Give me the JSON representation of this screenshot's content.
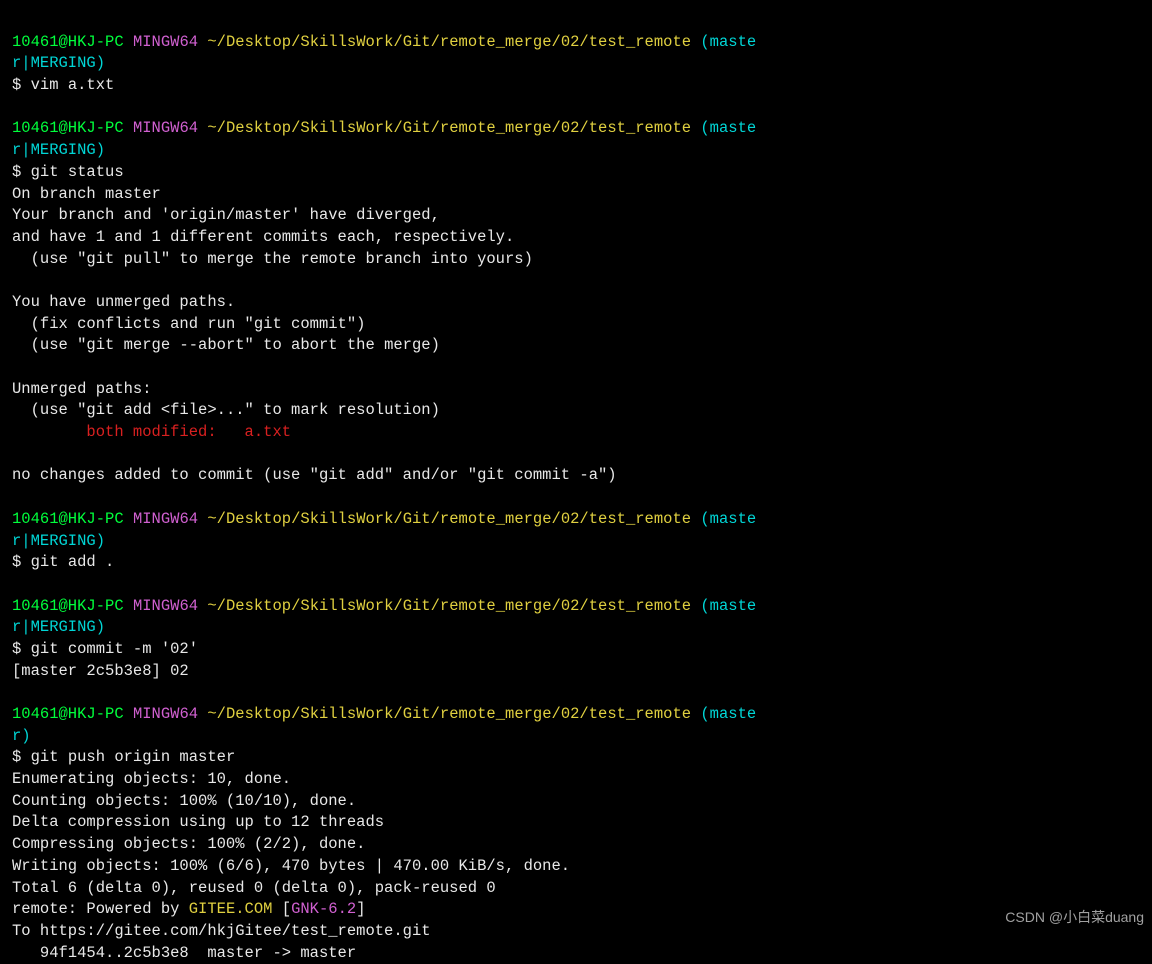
{
  "prompt": {
    "user_host": "10461@HKJ-PC",
    "shell": "MINGW64",
    "path": "~/Desktop/SkillsWork/Git/remote_merge/02/test_remote",
    "branch_merging_open": "(maste",
    "branch_merging_close": "r|MERGING)",
    "branch_master_open": "(maste",
    "branch_master_close": "r)",
    "dollar": "$ "
  },
  "cmd": {
    "vim": "vim a.txt",
    "status": "git status",
    "add": "git add .",
    "commit": "git commit -m '02'",
    "push": "git push origin master"
  },
  "status_out": {
    "l1": "On branch master",
    "l2": "Your branch and 'origin/master' have diverged,",
    "l3": "and have 1 and 1 different commits each, respectively.",
    "l4": "  (use \"git pull\" to merge the remote branch into yours)",
    "blank": "",
    "l5": "You have unmerged paths.",
    "l6": "  (fix conflicts and run \"git commit\")",
    "l7": "  (use \"git merge --abort\" to abort the merge)",
    "l8": "Unmerged paths:",
    "l9": "  (use \"git add <file>...\" to mark resolution)",
    "l10": "        both modified:   a.txt",
    "l11": "no changes added to commit (use \"git add\" and/or \"git commit -a\")"
  },
  "commit_out": {
    "l1": "[master 2c5b3e8] 02"
  },
  "push_out": {
    "l1": "Enumerating objects: 10, done.",
    "l2": "Counting objects: 100% (10/10), done.",
    "l3": "Delta compression using up to 12 threads",
    "l4": "Compressing objects: 100% (2/2), done.",
    "l5": "Writing objects: 100% (6/6), 470 bytes | 470.00 KiB/s, done.",
    "l6": "Total 6 (delta 0), reused 0 (delta 0), pack-reused 0",
    "l7a": "remote: Powered by ",
    "l7b": "GITEE.COM",
    "l7c": " [",
    "l7d": "GNK-6.2",
    "l7e": "]",
    "l8": "To https://gitee.com/hkjGitee/test_remote.git",
    "l9": "   94f1454..2c5b3e8  master -> master"
  },
  "watermark": "CSDN @小白菜duang"
}
